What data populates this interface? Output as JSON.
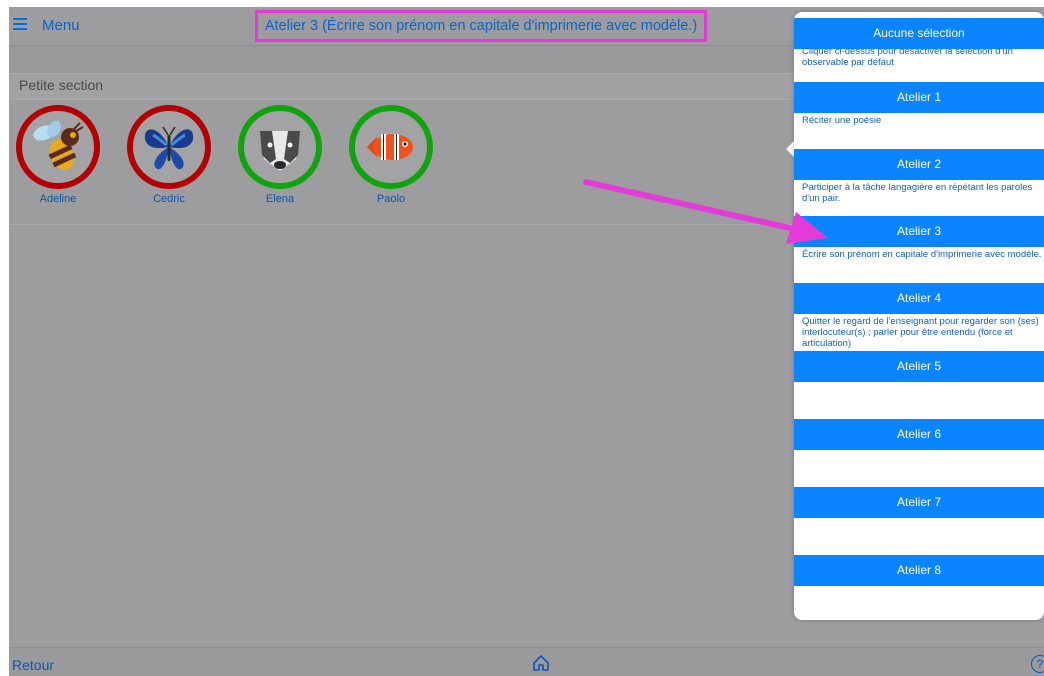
{
  "header": {
    "menu_label": "Menu",
    "title": "Atelier 3 (Écrire son prénom en capitale d'imprimerie avec modèle.)"
  },
  "section": {
    "title": "Petite section"
  },
  "students": [
    {
      "name": "Adeline",
      "ring_color": "#b30000",
      "icon": "bee-icon"
    },
    {
      "name": "Cedric",
      "ring_color": "#b30000",
      "icon": "butterfly-icon"
    },
    {
      "name": "Elena",
      "ring_color": "#0fa40f",
      "icon": "badger-icon"
    },
    {
      "name": "Paolo",
      "ring_color": "#0fa40f",
      "icon": "clownfish-icon"
    }
  ],
  "popover": {
    "options": [
      {
        "label": "Aucune sélection",
        "desc": "Cliquer ci-dessus pour désactiver la sélection d'un observable par défaut"
      },
      {
        "label": "Atelier 1",
        "desc": "Réciter une poésie"
      },
      {
        "label": "Atelier 2",
        "desc": "Participer à la tâche langagière en répétant les paroles d'un pair."
      },
      {
        "label": "Atelier 3",
        "desc": "Écrire son prénom en capitale d'imprimerie avec modèle."
      },
      {
        "label": "Atelier 4",
        "desc": "Quitter le regard de l'enseignant pour regarder son (ses) interlocuteur(s) ; parler pour être entendu (force et articulation)"
      },
      {
        "label": "Atelier 5",
        "desc": ""
      },
      {
        "label": "Atelier 6",
        "desc": ""
      },
      {
        "label": "Atelier 7",
        "desc": ""
      },
      {
        "label": "Atelier 8",
        "desc": ""
      }
    ]
  },
  "footer": {
    "back_label": "Retour",
    "help_label": "?"
  },
  "colors": {
    "accent": "#0a84ff",
    "annotation": "#e23bd8",
    "ring_red": "#b30000",
    "ring_green": "#0fa40f"
  }
}
